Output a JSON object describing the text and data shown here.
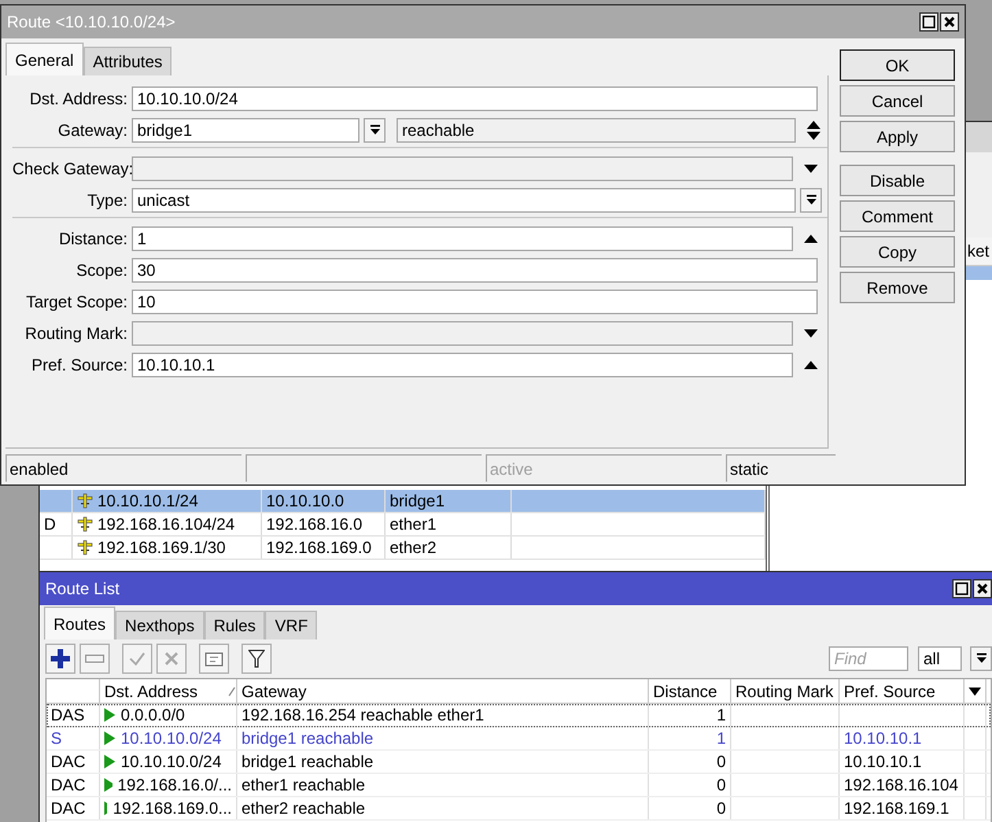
{
  "background_window": {
    "header_fragment": "ket",
    "rows": [
      {
        "selected": true
      }
    ]
  },
  "address_list": {
    "rows": [
      {
        "flag": "",
        "address": "10.10.10.1/24",
        "network": "10.10.10.0",
        "interface": "bridge1",
        "selected": true
      },
      {
        "flag": "D",
        "address": "192.168.16.104/24",
        "network": "192.168.16.0",
        "interface": "ether1",
        "selected": false
      },
      {
        "flag": "",
        "address": "192.168.169.1/30",
        "network": "192.168.169.0",
        "interface": "ether2",
        "selected": false
      }
    ]
  },
  "route_dialog": {
    "title": "Route <10.10.10.0/24>",
    "tabs": [
      {
        "label": "General",
        "selected": true
      },
      {
        "label": "Attributes",
        "selected": false
      }
    ],
    "sections": [
      [
        {
          "kind": "plain",
          "label": "Dst. Address:",
          "value": "10.10.10.0/24",
          "disabled": false
        },
        {
          "kind": "combo",
          "label": "Gateway:",
          "value": "bridge1",
          "status": "reachable",
          "disabled": false
        }
      ],
      [
        {
          "kind": "dropdown",
          "label": "Check Gateway:",
          "disabled": true
        },
        {
          "kind": "select",
          "label": "Type:",
          "value": "unicast",
          "disabled": false
        }
      ],
      [
        {
          "kind": "collapse",
          "label": "Distance:",
          "value": "1",
          "disabled": false
        },
        {
          "kind": "plain",
          "label": "Scope:",
          "value": "30",
          "disabled": false
        },
        {
          "kind": "plain",
          "label": "Target Scope:",
          "value": "10",
          "disabled": false
        },
        {
          "kind": "dropdown",
          "label": "Routing Mark:",
          "disabled": true
        },
        {
          "kind": "collapse",
          "label": "Pref. Source:",
          "value": "10.10.10.1",
          "disabled": false
        }
      ]
    ],
    "buttons": [
      {
        "label": "OK",
        "default": true
      },
      {
        "label": "Cancel",
        "default": false
      },
      {
        "label": "Apply",
        "default": false
      },
      {
        "label": "Disable",
        "default": false
      },
      {
        "label": "Comment",
        "default": false
      },
      {
        "label": "Copy",
        "default": false
      },
      {
        "label": "Remove",
        "default": false
      }
    ],
    "status_bar": [
      {
        "text": "enabled",
        "disabled": false
      },
      {
        "text": "active",
        "disabled": true
      },
      {
        "text": "static",
        "disabled": false
      }
    ]
  },
  "route_list": {
    "title": "Route List",
    "tabs": [
      {
        "label": "Routes",
        "selected": true
      },
      {
        "label": "Nexthops",
        "selected": false
      },
      {
        "label": "Rules",
        "selected": false
      },
      {
        "label": "VRF",
        "selected": false
      }
    ],
    "search": {
      "placeholder": "Find"
    },
    "filter": "all",
    "columns": [
      "Dst. Address",
      "Gateway",
      "Distance",
      "Routing Mark",
      "Pref. Source"
    ],
    "rows": [
      {
        "flags": "DAS",
        "dst": "0.0.0.0/0",
        "gateway": "192.168.16.254 reachable ether1",
        "distance": "1",
        "pref_source": "",
        "color": "#000000",
        "focused": true
      },
      {
        "flags": "S",
        "dst": "10.10.10.0/24",
        "gateway": "bridge1 reachable",
        "distance": "1",
        "pref_source": "10.10.10.1",
        "color": "#4444cc",
        "focused": false
      },
      {
        "flags": "DAC",
        "dst": "10.10.10.0/24",
        "gateway": "bridge1 reachable",
        "distance": "0",
        "pref_source": "10.10.10.1",
        "color": "#000000",
        "focused": false
      },
      {
        "flags": "DAC",
        "dst": "192.168.16.0/...",
        "gateway": "ether1 reachable",
        "distance": "0",
        "pref_source": "192.168.16.104",
        "color": "#000000",
        "focused": false
      },
      {
        "flags": "DAC",
        "dst": "192.168.169.0...",
        "gateway": "ether2 reachable",
        "distance": "0",
        "pref_source": "192.168.169.1",
        "color": "#000000",
        "focused": false
      }
    ]
  }
}
